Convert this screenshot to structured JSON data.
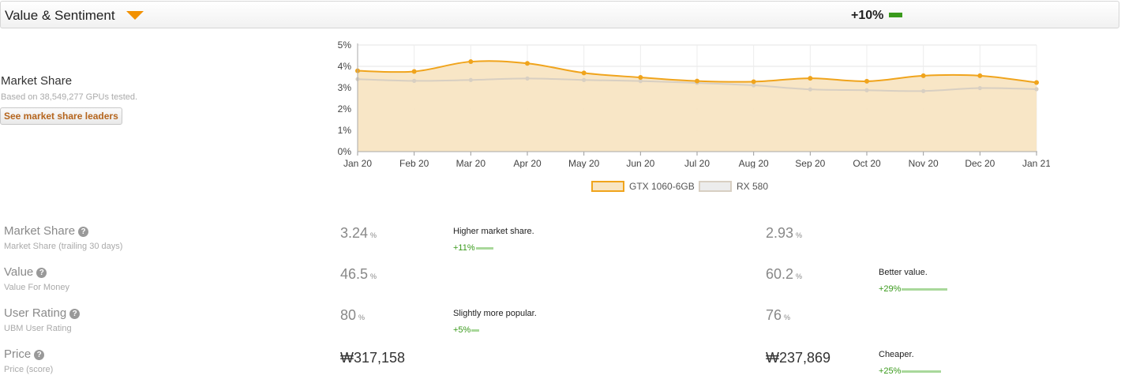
{
  "header": {
    "title": "Value & Sentiment",
    "delta": "+10%",
    "delta_color": "#3a9a1c",
    "accent": "#f29100"
  },
  "market_share_block": {
    "title": "Market Share",
    "subtitle": "Based on 38,549,277 GPUs tested.",
    "button": "See market share leaders"
  },
  "chart_data": {
    "type": "area",
    "x": [
      "Jan 20",
      "Feb 20",
      "Mar 20",
      "Apr 20",
      "May 20",
      "Jun 20",
      "Jul 20",
      "Aug 20",
      "Sep 20",
      "Oct 20",
      "Nov 20",
      "Dec 20",
      "Jan 21"
    ],
    "y_ticks": [
      "0%",
      "1%",
      "2%",
      "3%",
      "4%",
      "5%"
    ],
    "ylim": [
      0,
      5
    ],
    "grid": true,
    "legend_position": "bottom",
    "series": [
      {
        "name": "GTX 1060-6GB",
        "color": "#f0a41c",
        "fill": "#f8e5c3",
        "values": [
          3.79,
          3.76,
          4.22,
          4.14,
          3.69,
          3.48,
          3.31,
          3.28,
          3.44,
          3.3,
          3.56,
          3.56,
          3.24
        ]
      },
      {
        "name": "RX 580",
        "color": "#d8cfc2",
        "fill": "none",
        "values": [
          3.4,
          3.32,
          3.36,
          3.43,
          3.36,
          3.31,
          3.22,
          3.11,
          2.92,
          2.88,
          2.84,
          2.98,
          2.93
        ]
      }
    ]
  },
  "stats": [
    {
      "name": "Market Share",
      "sub": "Market Share (trailing 30 days)",
      "a": {
        "value": "3.24",
        "unit": "%"
      },
      "a_comment": {
        "text": "Higher market share.",
        "pct": "+11%"
      },
      "b": {
        "value": "2.93",
        "unit": "%"
      },
      "b_comment": {
        "text": "",
        "pct": ""
      }
    },
    {
      "name": "Value",
      "sub": "Value For Money",
      "a": {
        "value": "46.5",
        "unit": "%"
      },
      "a_comment": {
        "text": "",
        "pct": ""
      },
      "b": {
        "value": "60.2",
        "unit": "%"
      },
      "b_comment": {
        "text": "Better value.",
        "pct": "+29%"
      }
    },
    {
      "name": "User Rating",
      "sub": "UBM User Rating",
      "a": {
        "value": "80",
        "unit": "%"
      },
      "a_comment": {
        "text": "Slightly more popular.",
        "pct": "+5%"
      },
      "b": {
        "value": "76",
        "unit": "%"
      },
      "b_comment": {
        "text": "",
        "pct": ""
      }
    },
    {
      "name": "Price",
      "sub": "Price (score)",
      "a": {
        "value": "₩317,158",
        "unit": ""
      },
      "a_comment": {
        "text": "",
        "pct": ""
      },
      "b": {
        "value": "₩237,869",
        "unit": ""
      },
      "b_comment": {
        "text": "Cheaper.",
        "pct": "+25%"
      }
    }
  ]
}
